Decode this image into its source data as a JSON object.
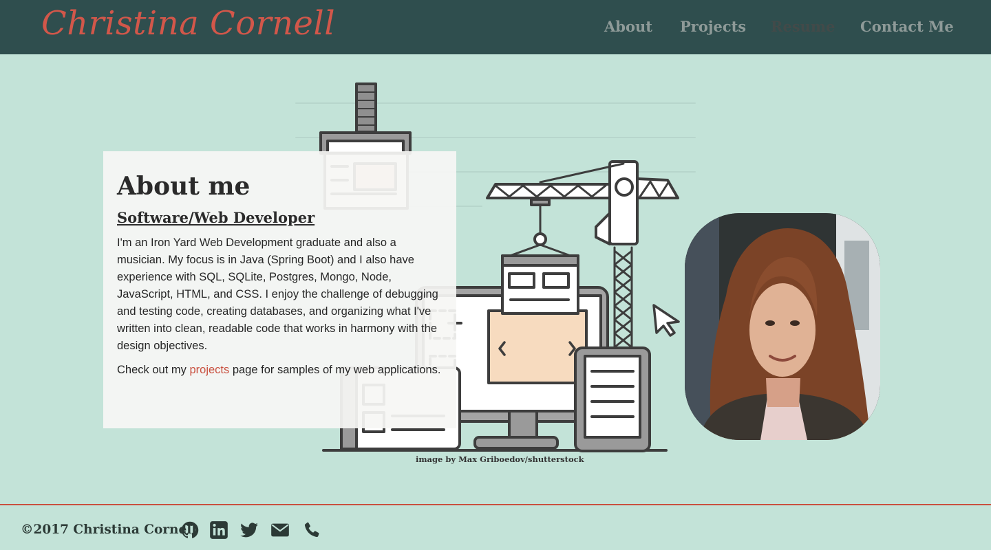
{
  "brand": "Christina Cornell",
  "nav": [
    {
      "label": "About"
    },
    {
      "label": "Projects"
    },
    {
      "label": "Resume"
    },
    {
      "label": "Contact Me"
    }
  ],
  "about": {
    "title": "About me",
    "subtitle": "Software/Web Developer",
    "paragraph": "I'm an Iron Yard Web Development graduate and also a musician. My focus is in Java (Spring Boot) and I also have experience with SQL, SQLite, Postgres, Mongo, Node, JavaScript, HTML, and CSS. I enjoy the challenge of debugging and testing code, creating databases, and organizing what I've written into clean, readable code that works in harmony with the design objectives.",
    "cta_before": "Check out my ",
    "cta_link": "projects",
    "cta_after": " page for samples of my web applications."
  },
  "image_credit": "image by Max Griboedov/shutterstock",
  "footer": {
    "copyright": "©2017 Christina Cornell",
    "social": [
      {
        "icon": "github-icon"
      },
      {
        "icon": "linkedin-icon"
      },
      {
        "icon": "twitter-icon"
      },
      {
        "icon": "envelope-icon"
      },
      {
        "icon": "phone-icon"
      }
    ]
  },
  "colors": {
    "header_bg": "#2f4e4e",
    "page_bg": "#c3e3d8",
    "brand": "#d2574a",
    "nav_text": "#8e9a98",
    "nav_active": "#424a49",
    "link": "#c9503f",
    "footer_rule": "#c9503f"
  }
}
